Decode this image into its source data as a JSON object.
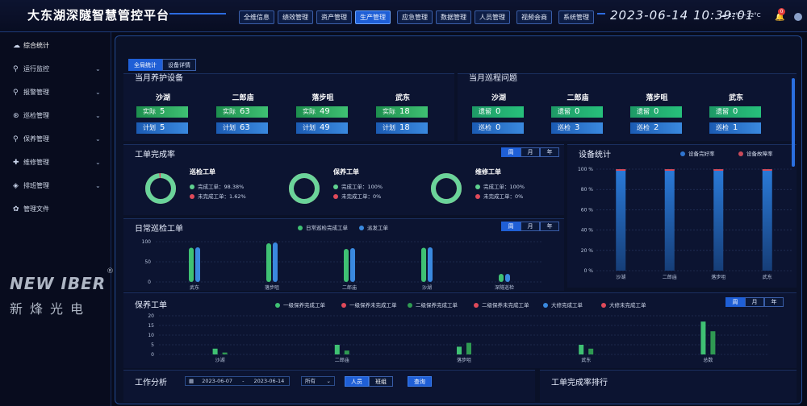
{
  "header": {
    "title": "大东湖深隧智慧管控平台",
    "nav": [
      "全维信息",
      "绩效管理",
      "资产管理",
      "生产管理",
      "应急管理",
      "数据管理",
      "人员管理",
      "视频会商",
      "系统管理"
    ],
    "active_nav": 3,
    "datetime": "2023-06-14 10:39:01",
    "weather": "22°C~32°C",
    "notifications": "0"
  },
  "sidebar": {
    "items": [
      {
        "label": "综合统计",
        "icon": "dashboard-icon",
        "expandable": false
      },
      {
        "label": "运行监控",
        "icon": "location-icon",
        "expandable": true
      },
      {
        "label": "报警管理",
        "icon": "location-icon",
        "expandable": true
      },
      {
        "label": "巡检管理",
        "icon": "inspect-icon",
        "expandable": true
      },
      {
        "label": "保养管理",
        "icon": "location-icon",
        "expandable": true
      },
      {
        "label": "维修管理",
        "icon": "repair-icon",
        "expandable": true
      },
      {
        "label": "排班管理",
        "icon": "schedule-icon",
        "expandable": true
      },
      {
        "label": "管理文件",
        "icon": "file-icon",
        "expandable": false
      }
    ],
    "logo_text": "NEW IBER",
    "logo_cn": "新烽光电",
    "logo_mark": "®"
  },
  "main": {
    "view_tabs": [
      "全局统计",
      "设备详情"
    ],
    "maint": {
      "title": "当月养护设备",
      "sites": [
        {
          "name": "沙湖",
          "actual": 5,
          "plan": 5
        },
        {
          "name": "二郎庙",
          "actual": 63,
          "plan": 63
        },
        {
          "name": "落步咀",
          "actual": 49,
          "plan": 49
        },
        {
          "name": "武东",
          "actual": 18,
          "plan": 18
        }
      ],
      "actual_label": "实际",
      "plan_label": "计划"
    },
    "patrol": {
      "title": "当月巡程问题",
      "sites": [
        {
          "name": "沙湖",
          "left": 0,
          "patrol": 0
        },
        {
          "name": "二郎庙",
          "left": 0,
          "patrol": 3
        },
        {
          "name": "落步咀",
          "left": 0,
          "patrol": 2
        },
        {
          "name": "武东",
          "left": 0,
          "patrol": 1
        }
      ],
      "left_label": "遗留",
      "patrol_label": "巡检"
    },
    "completion": {
      "title": "工单完成率",
      "period_tabs": [
        "周",
        "月",
        "年"
      ],
      "rings": [
        {
          "title": "巡检工单",
          "done_label": "完成工单：",
          "done": "98.38%",
          "undone_label": "未完成工单：",
          "undone": "1.62%",
          "pct": 98.38
        },
        {
          "title": "保养工单",
          "done_label": "完成工单：",
          "done": "100%",
          "undone_label": "未完成工单：",
          "undone": "0%",
          "pct": 100
        },
        {
          "title": "维修工单",
          "done_label": "完成工单：",
          "done": "100%",
          "undone_label": "未完成工单：",
          "undone": "0%",
          "pct": 100
        }
      ]
    },
    "equipment": {
      "title": "设备统计",
      "legend": [
        "设备完好率",
        "设备故障率"
      ]
    },
    "daily": {
      "title": "日常巡检工单",
      "period_tabs": [
        "周",
        "月",
        "年"
      ]
    },
    "upkeep": {
      "title": "保养工单",
      "period_tabs": [
        "周",
        "月",
        "年"
      ]
    },
    "work": {
      "title": "工作分析",
      "date_start": "2023-06-07",
      "date_sep": "-",
      "date_end": "2023-06-14",
      "select": "所有",
      "toggle": [
        "人员",
        "班组"
      ],
      "query": "查询"
    },
    "ranking": {
      "title": "工单完成率排行"
    }
  },
  "colors": {
    "accent": "#1f5fd6",
    "green": "#3fc173",
    "blue": "#3a89df",
    "red": "#e04a5a"
  },
  "chart_data": [
    {
      "type": "bar",
      "title": "设备统计",
      "categories": [
        "沙湖",
        "二郎庙",
        "落步咀",
        "武东"
      ],
      "series": [
        {
          "name": "设备完好率",
          "values": [
            100,
            100,
            100,
            100
          ]
        },
        {
          "name": "设备故障率",
          "values": [
            0,
            0,
            0,
            0
          ]
        }
      ],
      "yticks": [
        "0 %",
        "20 %",
        "40 %",
        "60 %",
        "80 %",
        "100 %"
      ],
      "ylim": [
        0,
        100
      ]
    },
    {
      "type": "bar",
      "title": "日常巡检工单",
      "categories": [
        "武东",
        "落步咀",
        "二郎庙",
        "沙湖",
        "深隧巡检"
      ],
      "series": [
        {
          "name": "日常巡检完成工单",
          "values": [
            85,
            96,
            82,
            85,
            20
          ]
        },
        {
          "name": "派发工单",
          "values": [
            86,
            98,
            84,
            86,
            20
          ]
        }
      ],
      "yticks": [
        "0",
        "50",
        "100"
      ],
      "ylim": [
        0,
        100
      ]
    },
    {
      "type": "bar",
      "title": "保养工单",
      "categories": [
        "沙湖",
        "二郎庙",
        "落步咀",
        "武东",
        "总数"
      ],
      "series": [
        {
          "name": "一级保养完成工单",
          "values": [
            3,
            5,
            4,
            5,
            17
          ]
        },
        {
          "name": "一级保养未完成工单",
          "values": [
            0,
            0,
            0,
            0,
            0
          ]
        },
        {
          "name": "二级保养完成工单",
          "values": [
            1,
            2,
            6,
            3,
            12
          ]
        },
        {
          "name": "二级保养未完成工单",
          "values": [
            0,
            0,
            0,
            0,
            0
          ]
        },
        {
          "name": "大修完成工单",
          "values": [
            0,
            0,
            0,
            0,
            0
          ]
        },
        {
          "name": "大修未完成工单",
          "values": [
            0,
            0,
            0,
            0,
            0
          ]
        }
      ],
      "yticks": [
        "0",
        "5",
        "10",
        "15",
        "20"
      ],
      "ylim": [
        0,
        20
      ]
    }
  ]
}
